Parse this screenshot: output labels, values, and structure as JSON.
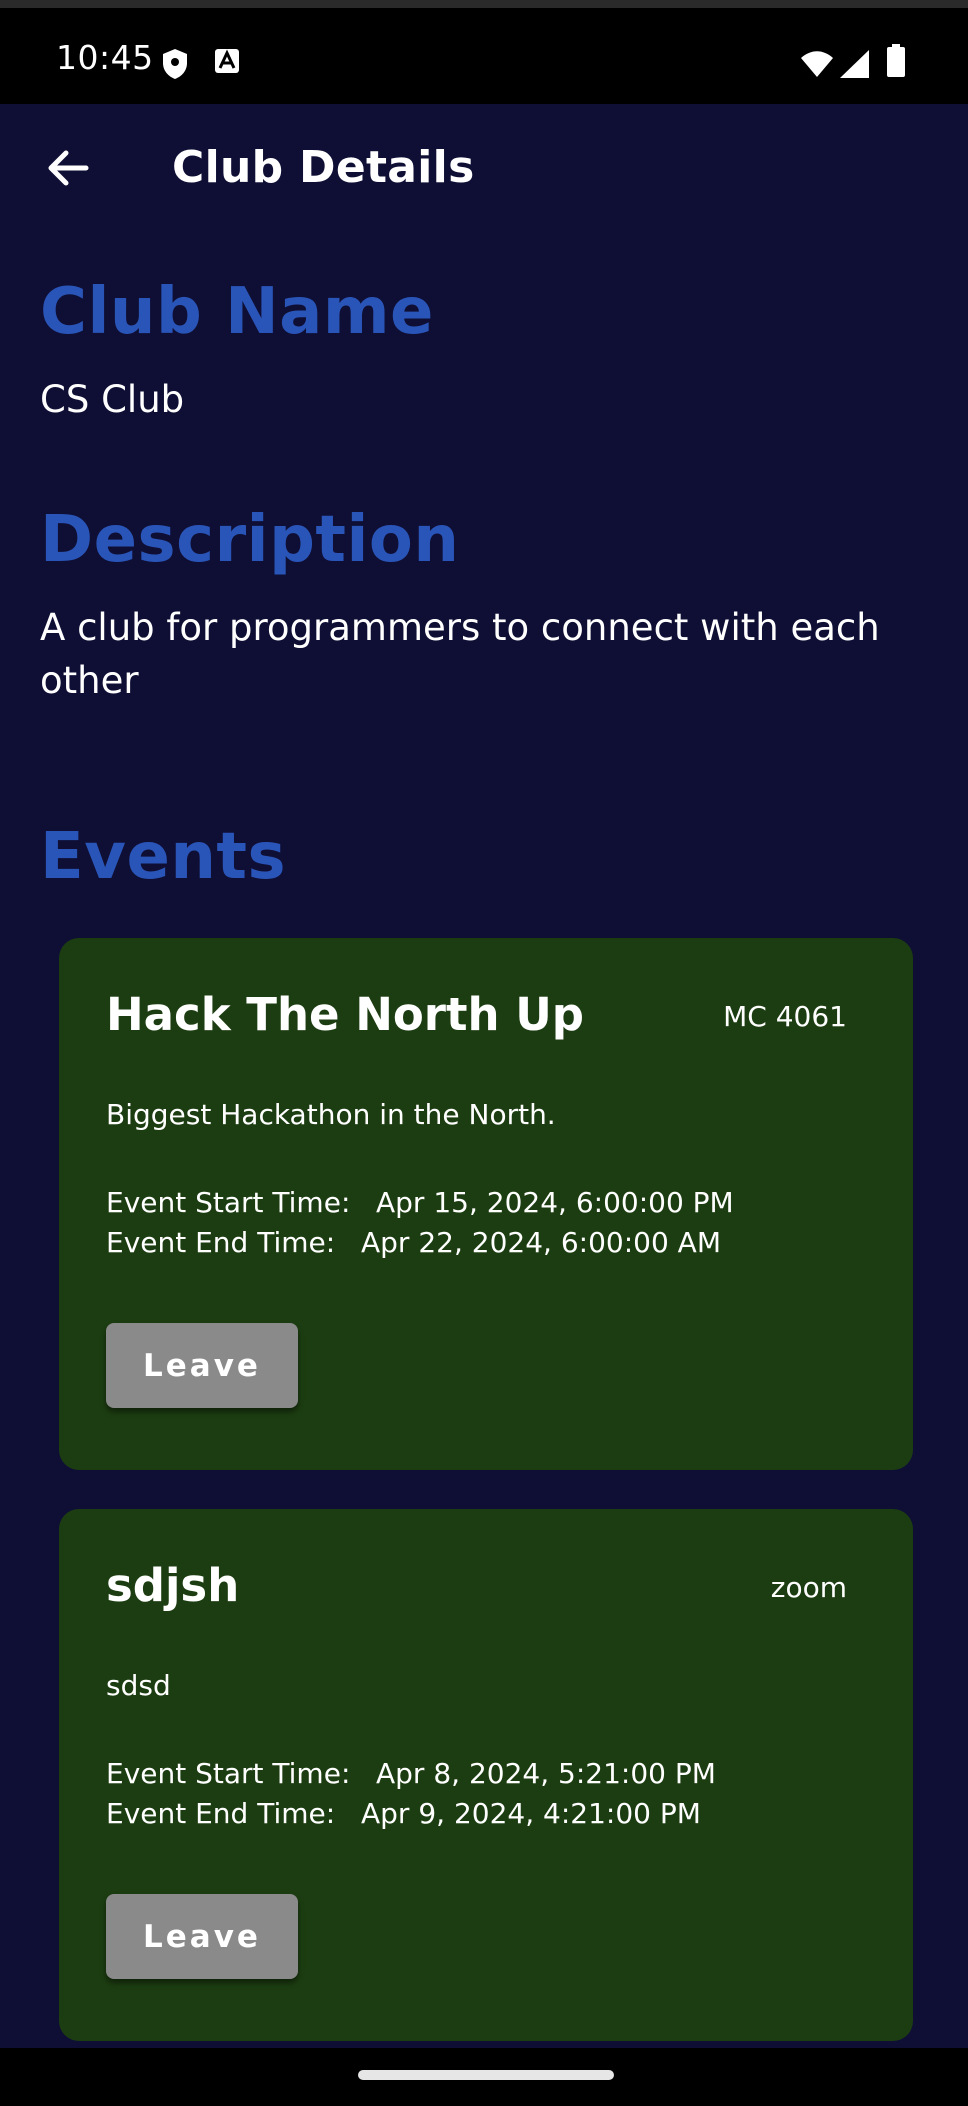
{
  "status_bar": {
    "time": "10:45"
  },
  "app_bar": {
    "title": "Club Details"
  },
  "club": {
    "name_heading": "Club Name",
    "name": "CS Club",
    "description_heading": "Description",
    "description": "A club for programmers to connect with each other"
  },
  "events_heading": "Events",
  "events": [
    {
      "title": "Hack The North Up",
      "location": "MC 4061",
      "description": "Biggest Hackathon in the North.",
      "start_label": "Event Start Time:",
      "start_time": "Apr 15, 2024, 6:00:00 PM",
      "end_label": "Event End Time:",
      "end_time": "Apr 22, 2024, 6:00:00 AM",
      "button_label": "Leave"
    },
    {
      "title": "sdjsh",
      "location": "zoom",
      "description": "sdsd",
      "start_label": "Event Start Time:",
      "start_time": "Apr 8, 2024, 5:21:00 PM",
      "end_label": "Event End Time:",
      "end_time": "Apr 9, 2024, 4:21:00 PM",
      "button_label": "Leave"
    }
  ],
  "colors": {
    "background": "#0f0f35",
    "heading": "#2a55b8",
    "card": "#1c3d11",
    "button": "#8a8a8a"
  },
  "icons": {
    "back": "arrow-back-icon",
    "shield": "shield-icon",
    "app_badge": "a-badge-icon",
    "wifi": "wifi-icon",
    "signal": "signal-icon",
    "battery": "battery-icon"
  }
}
